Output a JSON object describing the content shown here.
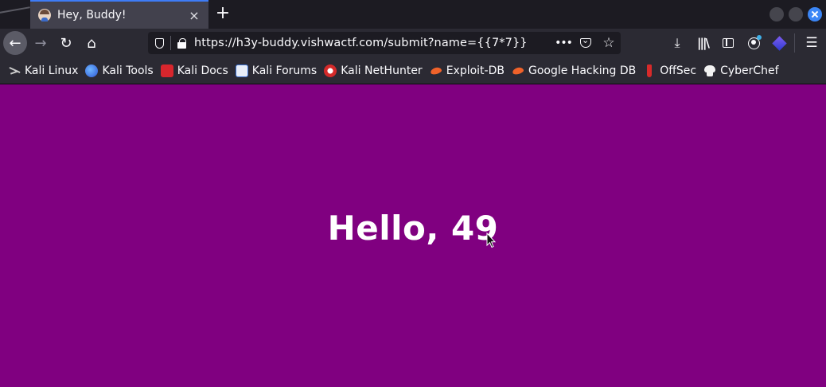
{
  "tab": {
    "title": "Hey, Buddy!",
    "close_icon": "×",
    "new_tab_icon": "+"
  },
  "nav": {
    "back_icon": "←",
    "forward_icon": "→",
    "reload_icon": "↻",
    "home_icon": "⌂"
  },
  "urlbar": {
    "url": "https://h3y-buddy.vishwactf.com/submit?name={{7*7}}",
    "page_actions_icon": "•••",
    "bookmark_star_icon": "☆"
  },
  "toolbar": {
    "download_icon": "⤓",
    "library_icon": "|||\\",
    "menu_icon": "☰"
  },
  "bookmarks": [
    {
      "label": "Kali Linux",
      "icon": "kali-dragon-icon"
    },
    {
      "label": "Kali Tools",
      "icon": "kali-tools-icon"
    },
    {
      "label": "Kali Docs",
      "icon": "kali-docs-icon"
    },
    {
      "label": "Kali Forums",
      "icon": "kali-forums-icon"
    },
    {
      "label": "Kali NetHunter",
      "icon": "nethunter-icon"
    },
    {
      "label": "Exploit-DB",
      "icon": "exploit-db-icon"
    },
    {
      "label": "Google Hacking DB",
      "icon": "ghdb-icon"
    },
    {
      "label": "OffSec",
      "icon": "offsec-icon"
    },
    {
      "label": "CyberChef",
      "icon": "cyberchef-icon"
    }
  ],
  "page": {
    "greeting": "Hello, 49",
    "background_color": "#800080"
  },
  "colors": {
    "tab_accent": "#3e7cf6",
    "toolbar_bg": "#2b2a33",
    "urlbar_bg": "#1c1b22"
  }
}
